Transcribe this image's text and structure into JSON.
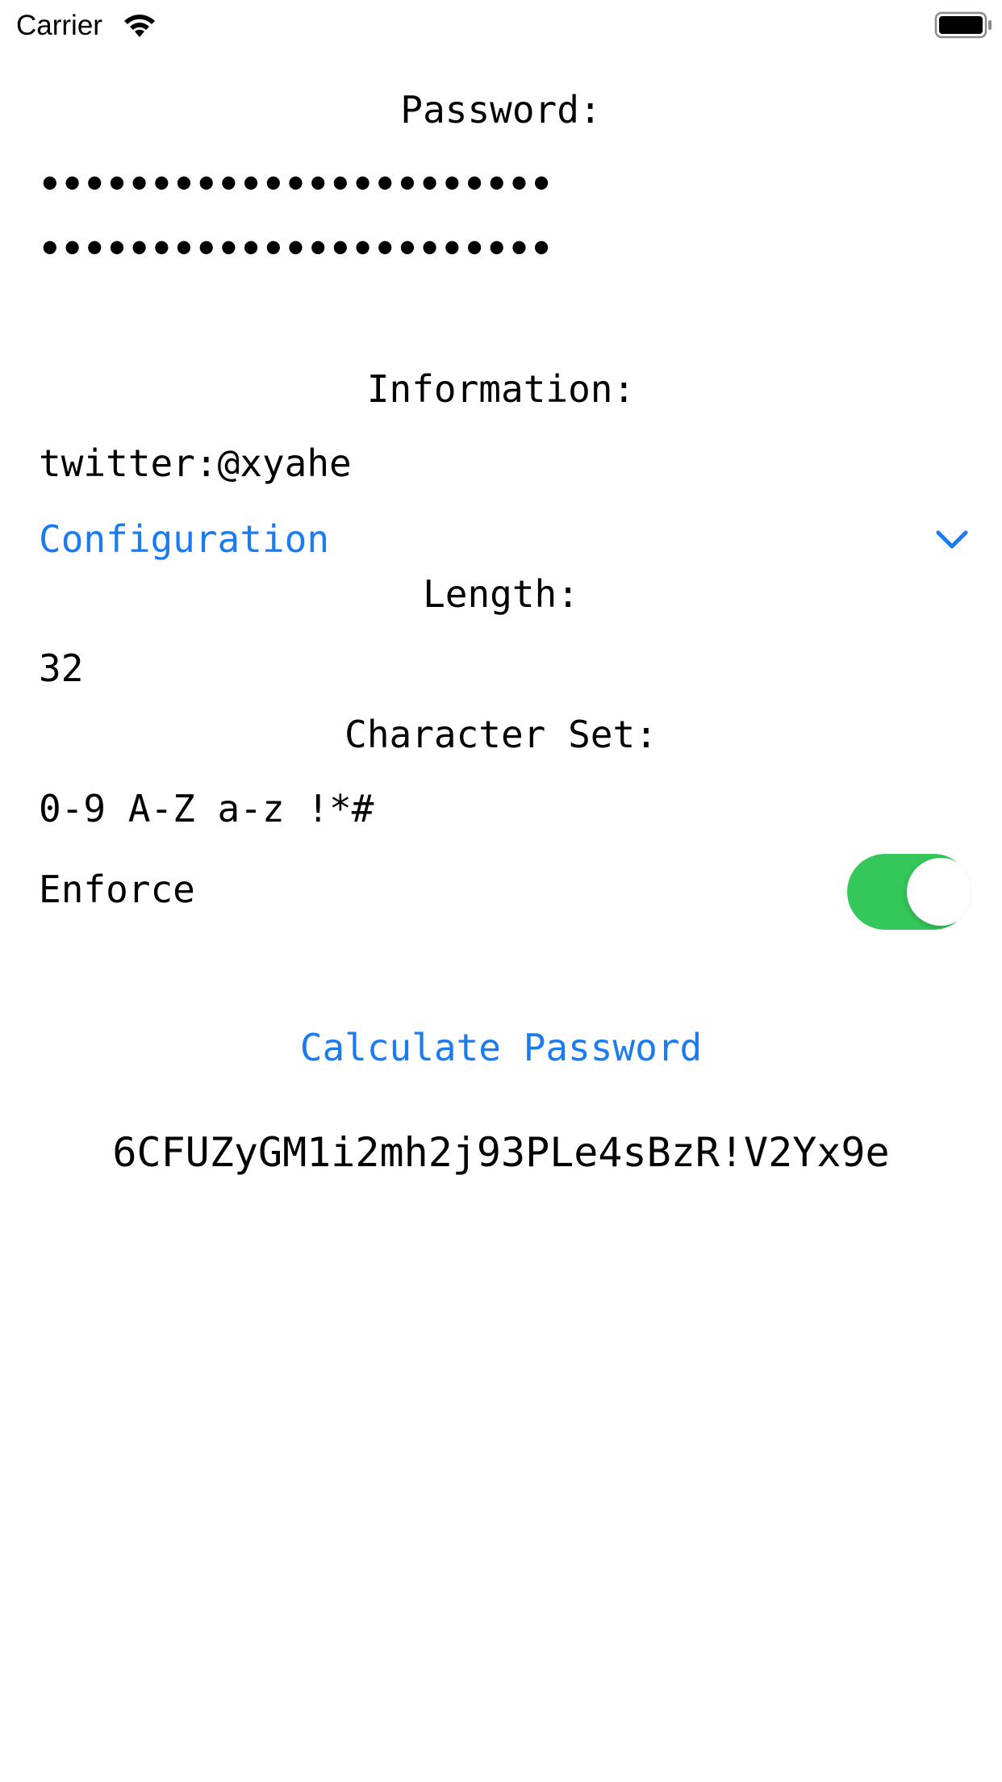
{
  "status_bar": {
    "carrier": "Carrier",
    "wifi_icon": "wifi-icon",
    "battery_icon": "battery-icon"
  },
  "password_section": {
    "label": "Password:",
    "field1_masked": "•••••••••••••••••••••••",
    "field2_masked": "•••••••••••••••••••••••"
  },
  "information_section": {
    "label": "Information:",
    "value": "twitter:@xyahe"
  },
  "configuration": {
    "label": "Configuration",
    "chevron_icon": "chevron-down-icon",
    "length_label": "Length:",
    "length_value": "32",
    "charset_label": "Character Set:",
    "charset_value": "0-9 A-Z a-z !*#",
    "enforce_label": "Enforce",
    "enforce_on": true
  },
  "actions": {
    "calculate_label": "Calculate Password"
  },
  "result": {
    "password": "6CFUZyGM1i2mh2j93PLe4sBzR!V2Yx9e"
  },
  "colors": {
    "accent": "#1a7cf0",
    "toggle_on": "#34c759"
  }
}
